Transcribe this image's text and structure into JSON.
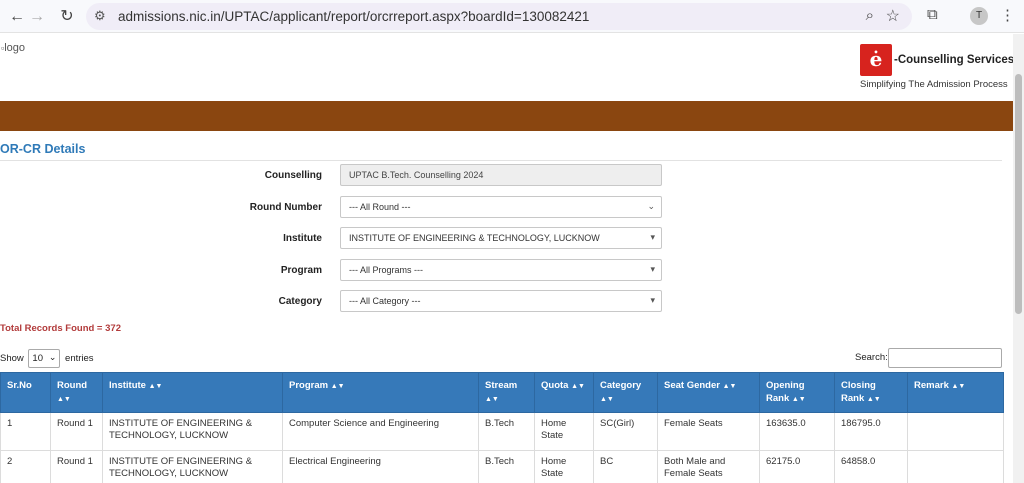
{
  "browser": {
    "url": "admissions.nic.in/UPTAC/applicant/report/orcrreport.aspx?boardId=130082421",
    "profile_initial": "T"
  },
  "header": {
    "logo_alt": "logo",
    "brand_title": "-Counselling Services",
    "brand_tagline": "Simplifying The Admission Process",
    "brand_emblem": "ė"
  },
  "section_title": "OR-CR Details",
  "filters": {
    "counselling": {
      "label": "Counselling",
      "value": "UPTAC B.Tech. Counselling 2024"
    },
    "round": {
      "label": "Round Number",
      "value": "--- All Round ---"
    },
    "institute": {
      "label": "Institute",
      "value": "INSTITUTE OF ENGINEERING & TECHNOLOGY, LUCKNOW"
    },
    "program": {
      "label": "Program",
      "value": "--- All Programs ---"
    },
    "category": {
      "label": "Category",
      "value": "--- All Category ---"
    }
  },
  "total_records": "Total Records Found = 372",
  "table_controls": {
    "show_label": "Show",
    "entries_value": "10",
    "entries_label": "entries",
    "search_label": "Search:"
  },
  "table": {
    "columns": [
      {
        "label": "Sr.No",
        "sortable": false
      },
      {
        "label": "Round",
        "sortable": true
      },
      {
        "label": "Institute",
        "sortable": true
      },
      {
        "label": "Program",
        "sortable": true
      },
      {
        "label": "Stream",
        "sortable": true
      },
      {
        "label": "Quota",
        "sortable": true
      },
      {
        "label": "Category",
        "sortable": true
      },
      {
        "label": "Seat Gender",
        "sortable": true
      },
      {
        "label": "Opening Rank",
        "sortable": true
      },
      {
        "label": "Closing Rank",
        "sortable": true
      },
      {
        "label": "Remark",
        "sortable": true
      }
    ],
    "sort_glyph": "▲▼",
    "rows": [
      [
        "1",
        "Round 1",
        "INSTITUTE OF ENGINEERING & TECHNOLOGY, LUCKNOW",
        "Computer Science and Engineering",
        "B.Tech",
        "Home State",
        "SC(Girl)",
        "Female Seats",
        "163635.0",
        "186795.0",
        ""
      ],
      [
        "2",
        "Round 1",
        "INSTITUTE OF ENGINEERING & TECHNOLOGY, LUCKNOW",
        "Electrical Engineering",
        "B.Tech",
        "Home State",
        "BC",
        "Both Male and Female Seats",
        "62175.0",
        "64858.0",
        ""
      ]
    ]
  }
}
